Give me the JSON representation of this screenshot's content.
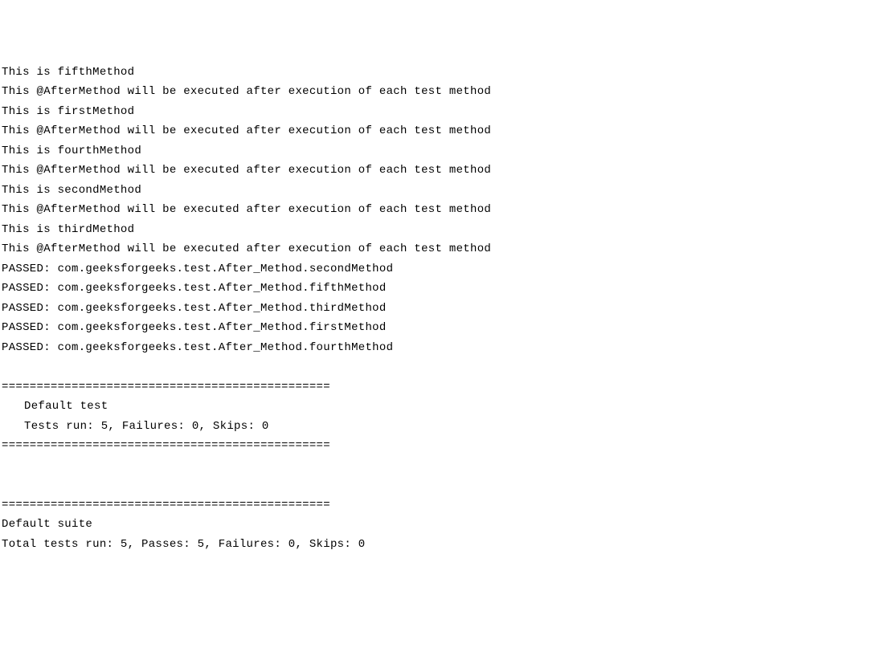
{
  "console": {
    "lines": [
      {
        "text": "This is fifthMethod",
        "indent": false
      },
      {
        "text": "This @AfterMethod will be executed after execution of each test method",
        "indent": false
      },
      {
        "text": "This is firstMethod",
        "indent": false
      },
      {
        "text": "This @AfterMethod will be executed after execution of each test method",
        "indent": false
      },
      {
        "text": "This is fourthMethod",
        "indent": false
      },
      {
        "text": "This @AfterMethod will be executed after execution of each test method",
        "indent": false
      },
      {
        "text": "This is secondMethod",
        "indent": false
      },
      {
        "text": "This @AfterMethod will be executed after execution of each test method",
        "indent": false
      },
      {
        "text": "This is thirdMethod",
        "indent": false
      },
      {
        "text": "This @AfterMethod will be executed after execution of each test method",
        "indent": false
      },
      {
        "text": "PASSED: com.geeksforgeeks.test.After_Method.secondMethod",
        "indent": false
      },
      {
        "text": "PASSED: com.geeksforgeeks.test.After_Method.fifthMethod",
        "indent": false
      },
      {
        "text": "PASSED: com.geeksforgeeks.test.After_Method.thirdMethod",
        "indent": false
      },
      {
        "text": "PASSED: com.geeksforgeeks.test.After_Method.firstMethod",
        "indent": false
      },
      {
        "text": "PASSED: com.geeksforgeeks.test.After_Method.fourthMethod",
        "indent": false
      },
      {
        "text": "",
        "indent": false
      },
      {
        "text": "===============================================",
        "indent": false
      },
      {
        "text": "Default test",
        "indent": true
      },
      {
        "text": "Tests run: 5, Failures: 0, Skips: 0",
        "indent": true
      },
      {
        "text": "===============================================",
        "indent": false
      },
      {
        "text": "",
        "indent": false
      },
      {
        "text": "",
        "indent": false
      },
      {
        "text": "===============================================",
        "indent": false
      },
      {
        "text": "Default suite",
        "indent": false
      },
      {
        "text": "Total tests run: 5, Passes: 5, Failures: 0, Skips: 0",
        "indent": false
      }
    ]
  }
}
